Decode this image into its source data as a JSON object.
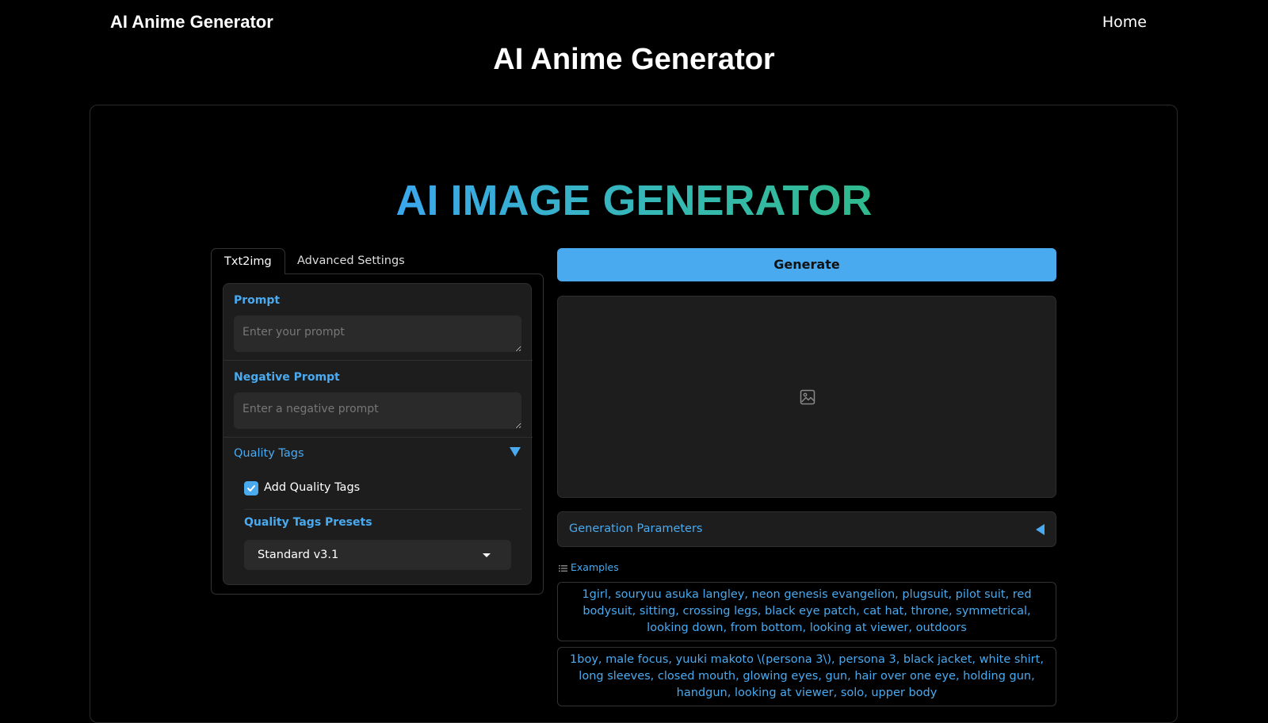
{
  "header": {
    "site_title": "AI Anime Generator",
    "home_link": "Home"
  },
  "page_heading": "AI Anime Generator",
  "app_title": "AI IMAGE GENERATOR",
  "tabs": [
    {
      "label": "Txt2img",
      "active": true
    },
    {
      "label": "Advanced Settings",
      "active": false
    }
  ],
  "form": {
    "prompt_label": "Prompt",
    "prompt_placeholder": "Enter your prompt",
    "prompt_value": "",
    "negative_prompt_label": "Negative Prompt",
    "negative_prompt_placeholder": "Enter a negative prompt",
    "negative_prompt_value": "",
    "quality_tags_label": "Quality Tags",
    "add_quality_tags_label": "Add Quality Tags",
    "add_quality_tags_checked": true,
    "presets_label": "Quality Tags Presets",
    "presets_selected": "Standard v3.1"
  },
  "output": {
    "generate_label": "Generate",
    "generation_parameters_label": "Generation Parameters",
    "examples_label": "Examples",
    "examples": [
      "1girl, souryuu asuka langley, neon genesis evangelion, plugsuit, pilot suit, red bodysuit, sitting, crossing legs, black eye patch, cat hat, throne, symmetrical, looking down, from bottom, looking at viewer, outdoors",
      "1boy, male focus, yuuki makoto \\(persona 3\\), persona 3, black jacket, white shirt, long sleeves, closed mouth, glowing eyes, gun, hair over one eye, holding gun, handgun, looking at viewer, solo, upper body"
    ]
  },
  "colors": {
    "accent": "#4aaaf0",
    "background": "#000000",
    "panel": "#1d1d1d",
    "input": "#2a2a2a"
  }
}
